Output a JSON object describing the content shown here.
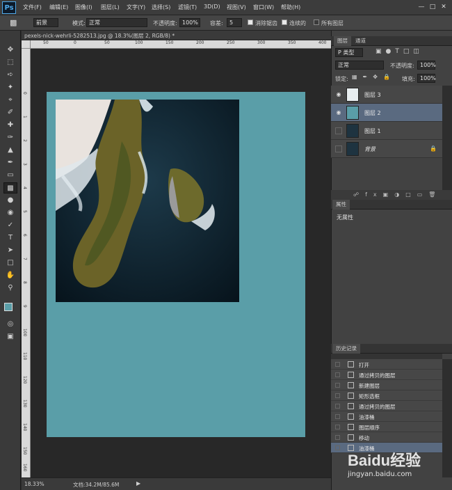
{
  "app": {
    "logo": "Ps"
  },
  "menu": [
    "文件(F)",
    "编辑(E)",
    "图像(I)",
    "图层(L)",
    "文字(Y)",
    "选择(S)",
    "滤镜(T)",
    "3D(D)",
    "视图(V)",
    "窗口(W)",
    "帮助(H)"
  ],
  "window_controls": [
    "—",
    "□",
    "✕"
  ],
  "options": {
    "fill_source": "前景",
    "mode_label": "模式:",
    "mode_value": "正常",
    "opacity_label": "不透明度:",
    "opacity_value": "100%",
    "tolerance_label": "容差:",
    "tolerance_value": "5",
    "antialias_label": "消除锯齿",
    "contiguous_label": "连续的",
    "all_layers_label": "所有图层"
  },
  "document": {
    "tab_title": "pexels-nick-wehrli-5282513.jpg @ 18.3%(图层 2, RGB/8) *",
    "zoom": "18.33%",
    "doc_size": "文档:34.2M/85.6M",
    "canvas_color": "#5a9ea8"
  },
  "rulers": {
    "h_labels": [
      "50",
      "0",
      "50",
      "100",
      "150",
      "200",
      "250",
      "300",
      "350",
      "400"
    ],
    "v_labels": [
      "0",
      "1",
      "2",
      "3",
      "4",
      "5",
      "6",
      "7",
      "8",
      "9",
      "100",
      "110",
      "120",
      "130",
      "140",
      "150",
      "160"
    ]
  },
  "layers_panel": {
    "tabs": [
      "图层",
      "通道"
    ],
    "kind_filter": "P 类型",
    "blend_mode": "正常",
    "opacity_label": "不透明度:",
    "opacity_value": "100%",
    "lock_label": "锁定:",
    "fill_label": "填充:",
    "fill_value": "100%",
    "layers": [
      {
        "name": "图层 3",
        "selected": false,
        "visible": true
      },
      {
        "name": "图层 2",
        "selected": true,
        "visible": true
      },
      {
        "name": "图层 1",
        "selected": false,
        "visible": false
      },
      {
        "name": "背景",
        "selected": false,
        "visible": false
      }
    ]
  },
  "properties_panel": {
    "tab": "属性",
    "content": "无属性"
  },
  "history_panel": {
    "tab": "历史记录",
    "items": [
      "打开",
      "通过拷贝的图层",
      "新建图层",
      "矩形选框",
      "通过拷贝的图层",
      "油漆桶",
      "图层顺序",
      "移动",
      "油漆桶"
    ]
  },
  "watermark": {
    "brand": "Baidu经验",
    "url": "jingyan.baidu.com"
  }
}
